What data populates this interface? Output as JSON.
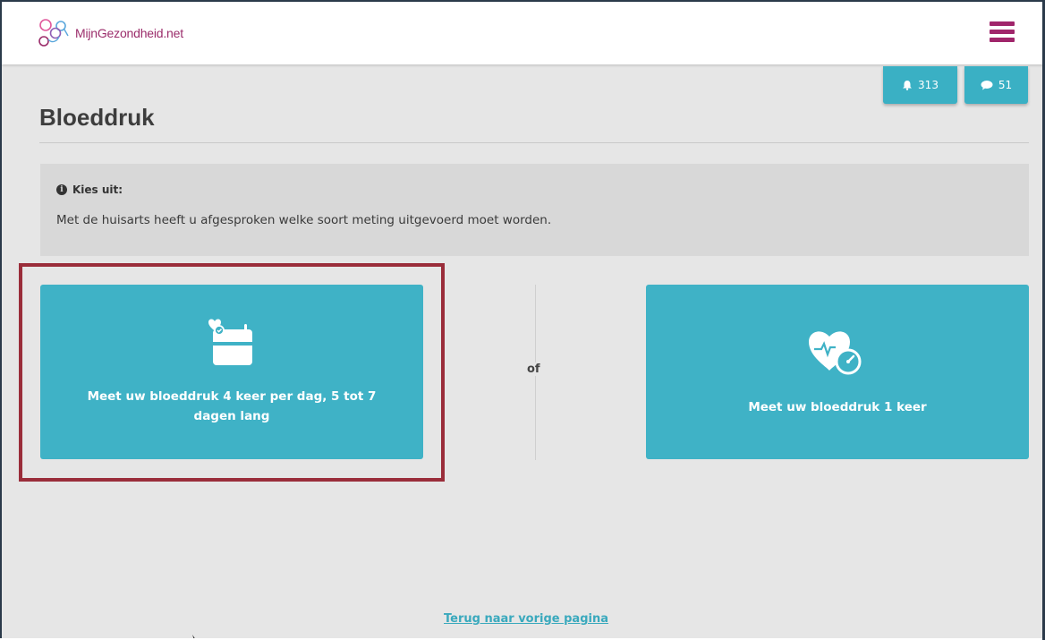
{
  "header": {
    "logo_text": "MijnGezondheid.net",
    "menu_icon": "hamburger-icon"
  },
  "notifications": {
    "alerts_count": "313",
    "messages_count": "51",
    "alerts_icon": "bell-icon",
    "messages_icon": "chat-bubble-icon"
  },
  "page": {
    "title": "Bloeddruk"
  },
  "info": {
    "heading": "Kies uit:",
    "text": "Met de huisarts heeft u afgesproken welke soort meting uitgevoerd moet worden.",
    "icon": "info-icon"
  },
  "choices": {
    "option_multi": {
      "label": "Meet uw bloeddruk 4 keer per dag, 5 tot 7 dagen lang",
      "icon": "calendar-heart-icon"
    },
    "separator": "of",
    "option_single": {
      "label": "Meet uw bloeddruk 1 keer",
      "icon": "heart-gauge-icon"
    }
  },
  "footer": {
    "back_link": "Terug naar vorige pagina"
  },
  "colors": {
    "accent": "#3fb2c6",
    "brand": "#a0256b",
    "highlight": "#9a2d3a"
  }
}
